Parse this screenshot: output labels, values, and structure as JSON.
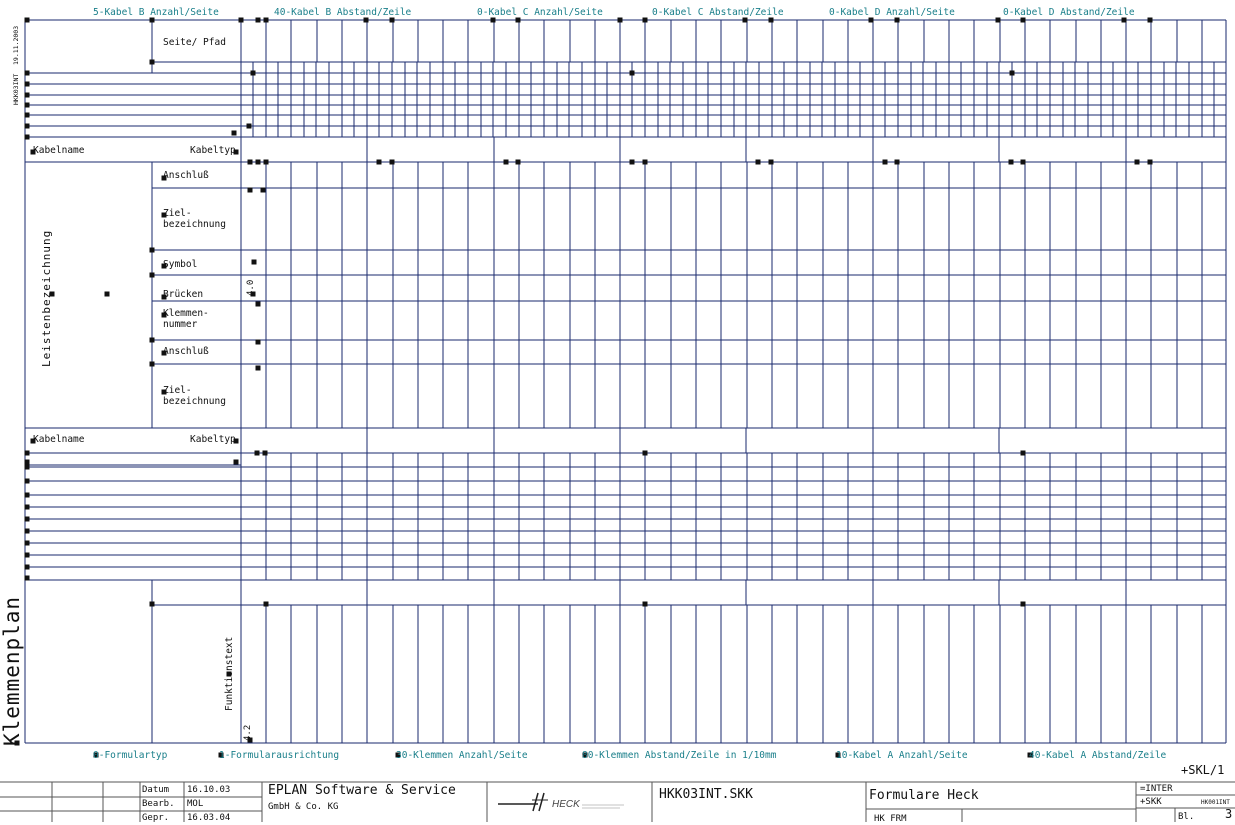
{
  "header_params": [
    "5-Kabel B Anzahl/Seite",
    "40-Kabel B Abstand/Zeile",
    "0-Kabel C Anzahl/Seite",
    "0-Kabel C Abstand/Zeile",
    "0-Kabel D Anzahl/Seite",
    "0-Kabel D Abstand/Zeile"
  ],
  "footer_params": [
    "0-Formulartyp",
    "1-Formularausrichtung",
    "30-Klemmen Anzahl/Seite",
    "80-Klemmen Abstand/Zeile in 1/10mm",
    "10-Kabel A Anzahl/Seite",
    "40-Kabel A Abstand/Zeile"
  ],
  "labels": {
    "seite_pfad": "Seite/ Pfad",
    "kabelname_1": "Kabelname",
    "kabeltyp_1": "Kabeltyp",
    "anschluss_1": "Anschluß",
    "ziel_1a": "Ziel-",
    "ziel_1b": "bezeichnung",
    "symbol": "Symbol",
    "bruecken": "Brücken",
    "klemmen_a": "Klemmen-",
    "klemmen_b": "nummer",
    "anschluss_2": "Anschluß",
    "ziel_2a": "Ziel-",
    "ziel_2b": "bezeichnung",
    "kabelname_2": "Kabelname",
    "kabeltyp_2": "Kabeltyp",
    "leistenbezeichnung": "Leistenbezeichnung",
    "funktionstext": "Funktionstext",
    "klemmenplan": "Klemmenplan",
    "hkk_side": "HKK03INT",
    "date_side": "19.11.2003",
    "num_40": "4.0",
    "num_42": "4.2",
    "skl": "+SKL/1"
  },
  "title_block": {
    "datum_label": "Datum",
    "datum_value": "16.10.03",
    "bearb_label": "Bearb.",
    "bearb_value": "MOL",
    "gepr_label": "Gepr.",
    "gepr_value": "16.03.04",
    "company_line1": "EPLAN Software & Service",
    "company_line2": "GmbH & Co. KG",
    "logo_text": "HECK",
    "filename": "HKK03INT.SKK",
    "form_title": "Formulare Heck",
    "form_sub": "HK FRM",
    "inter": "=INTER",
    "skk": "+SKK",
    "code": "HK001INT",
    "bl_label": "Bl.",
    "bl_value": "3"
  },
  "colors": {
    "grid": "#1a2a6e",
    "teal": "#1a7f8a",
    "ink": "#111111"
  }
}
